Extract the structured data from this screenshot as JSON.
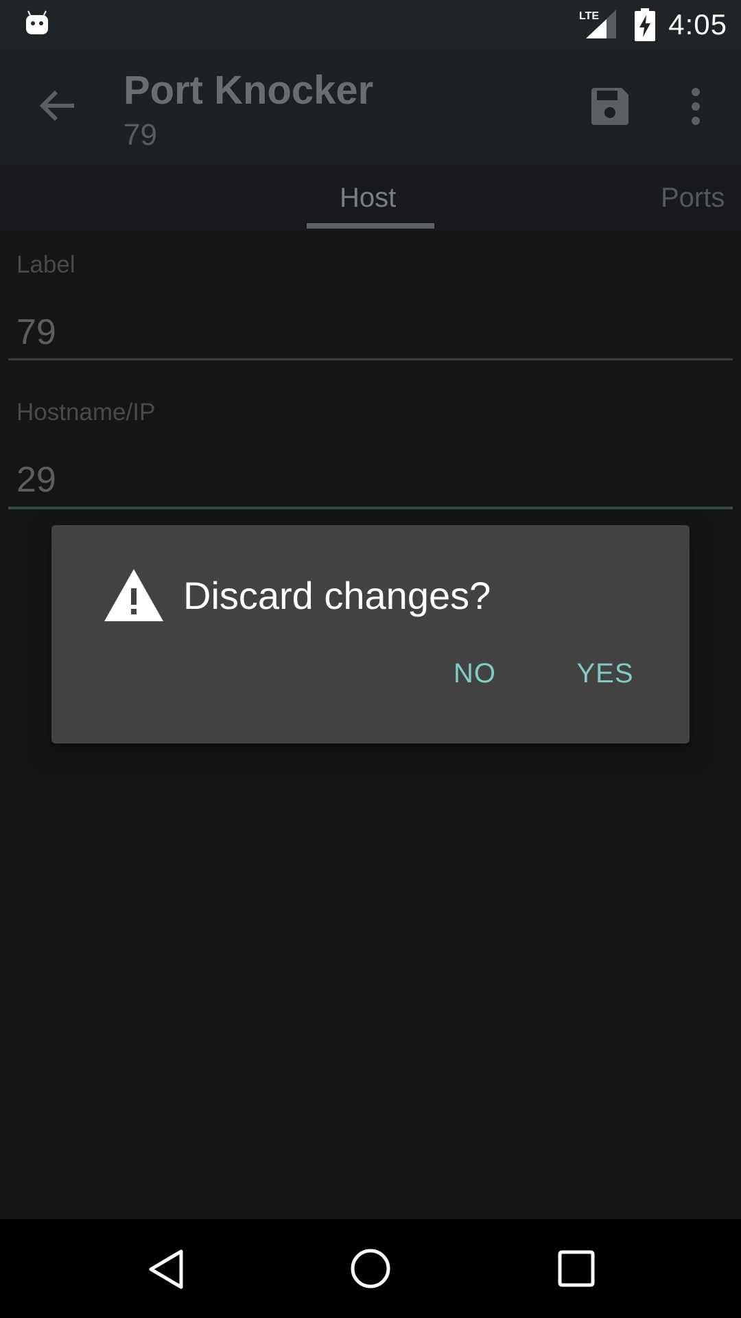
{
  "status_bar": {
    "time": "4:05",
    "network": "LTE",
    "left_icon": "android-notification-icon",
    "signal_icon": "signal-icon",
    "battery_icon": "battery-charging-icon"
  },
  "app_bar": {
    "title": "Port Knocker",
    "subtitle": "79",
    "back_icon": "arrow-back-icon",
    "save_icon": "save-icon",
    "more_icon": "more-vert-icon"
  },
  "tabs": [
    {
      "label": "Host",
      "selected": true
    },
    {
      "label": "Ports",
      "selected": false
    }
  ],
  "form": {
    "label_field": {
      "label": "Label",
      "value": "79"
    },
    "host_field": {
      "label": "Hostname/IP",
      "value": "29"
    }
  },
  "dialog": {
    "title": "Discard changes?",
    "icon": "warning-icon",
    "no_label": "NO",
    "yes_label": "YES"
  },
  "nav_bar": {
    "back_icon": "nav-back-icon",
    "home_icon": "nav-home-icon",
    "recents_icon": "nav-recents-icon"
  },
  "colors": {
    "accent": "#80cbc4",
    "dialog_bg": "#424242",
    "app_bar_bg": "#1c2025",
    "background": "#151515"
  }
}
